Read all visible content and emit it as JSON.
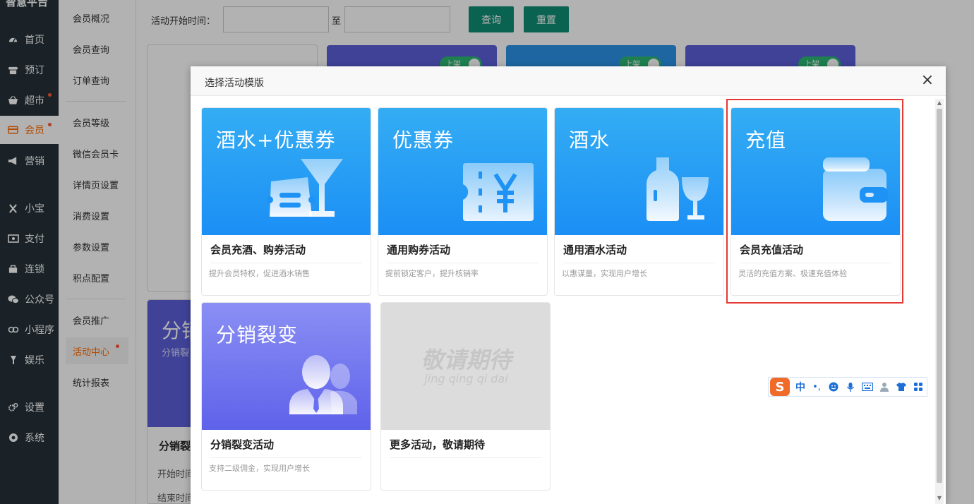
{
  "app": {
    "logo": "智慧平台"
  },
  "nav": {
    "items": [
      {
        "label": "首页",
        "icon": "dashboard-icon"
      },
      {
        "label": "预订",
        "icon": "phone-icon"
      },
      {
        "label": "超市",
        "icon": "basket-icon"
      },
      {
        "label": "会员",
        "icon": "member-card-icon"
      },
      {
        "label": "营销",
        "icon": "megaphone-icon"
      },
      {
        "label": "小宝",
        "icon": "x-icon"
      },
      {
        "label": "支付",
        "icon": "cash-icon"
      },
      {
        "label": "连锁",
        "icon": "store-icon"
      },
      {
        "label": "公众号",
        "icon": "wechat-icon"
      },
      {
        "label": "小程序",
        "icon": "miniprogram-icon"
      },
      {
        "label": "娱乐",
        "icon": "microphone-icon"
      },
      {
        "label": "设置",
        "icon": "gear-icon"
      },
      {
        "label": "系统",
        "icon": "chrome-icon"
      }
    ],
    "active": "会员"
  },
  "subnav": {
    "items": [
      "会员概况",
      "会员查询",
      "订单查询",
      "会员等级",
      "微信会员卡",
      "详情页设置",
      "消费设置",
      "参数设置",
      "积点配置",
      "会员推广",
      "活动中心",
      "统计报表"
    ],
    "active": "活动中心"
  },
  "filter": {
    "label": "活动开始时间：",
    "to": "至",
    "query_button": "查询",
    "reset_button": "重置"
  },
  "background": {
    "toggle_label": "上架",
    "card_title": "分销",
    "card_sub": "分销裂",
    "list_title": "分销裂",
    "start_label": "开始时间",
    "end_label": "结束时间"
  },
  "modal": {
    "title": "选择活动模版",
    "close": "×",
    "templates": [
      {
        "big": "酒水+优惠券",
        "name": "会员充酒、购券活动",
        "desc": "提升会员特权，促进酒水销售",
        "icon": "cocktail-coupon-icon"
      },
      {
        "big": "优惠券",
        "name": "通用购券活动",
        "desc": "提前锁定客户，提升核销率",
        "icon": "yen-ticket-icon"
      },
      {
        "big": "酒水",
        "name": "通用酒水活动",
        "desc": "以惠谋量，实现用户增长",
        "icon": "bottle-glass-icon"
      },
      {
        "big": "充值",
        "name": "会员充值活动",
        "desc": "灵活的充值方案、极速充值体验",
        "icon": "wallet-icon"
      },
      {
        "big": "分销裂变",
        "name": "分销裂变活动",
        "desc": "支持二级佣金，实现用户增长",
        "icon": "users-icon"
      }
    ],
    "coming_soon": {
      "cn": "敬请期待",
      "pinyin": "jing qing qi dai",
      "name": "更多活动，敬请期待"
    }
  },
  "ime": {
    "logo": "S",
    "mode": "中",
    "punct": "•,"
  }
}
